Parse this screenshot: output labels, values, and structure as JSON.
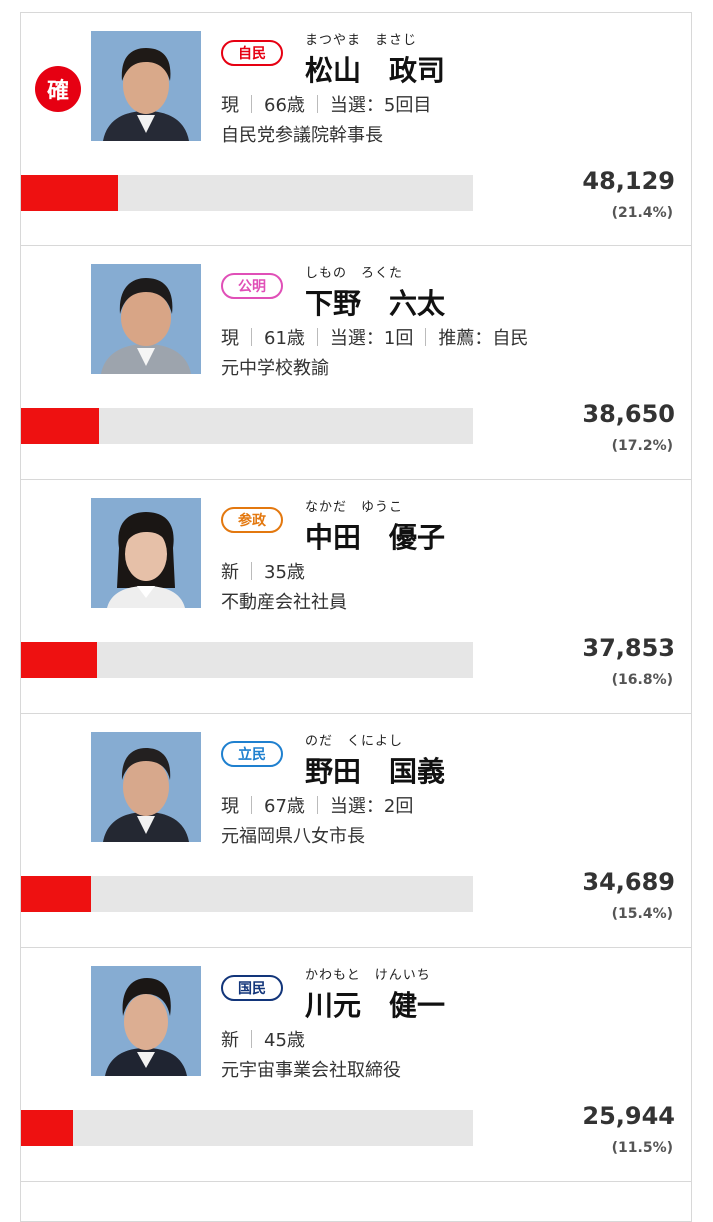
{
  "candidates": [
    {
      "elected_label": "確",
      "party": "自民",
      "party_color": "#e60012",
      "furigana": "まつやま　まさじ",
      "name": "松山　政司",
      "meta": [
        "現",
        "66歳",
        "当選：5回目"
      ],
      "title": "自民党参議院幹事長",
      "votes": "48,129",
      "percent": "(21.4%)",
      "bar_fraction": 0.214,
      "photo": {
        "bg": "#86acd2",
        "hair": "#1f1a17",
        "skin": "#d9a98a",
        "suit": "#262a36",
        "shirt": "#f2f2f2"
      }
    },
    {
      "party": "公明",
      "party_color": "#e04fb7",
      "furigana": "しもの　ろくた",
      "name": "下野　六太",
      "meta": [
        "現",
        "61歳",
        "当選：1回",
        "推薦：自民"
      ],
      "title": "元中学校教諭",
      "votes": "38,650",
      "percent": "(17.2%)",
      "bar_fraction": 0.172,
      "photo": {
        "bg": "#86acd2",
        "hair": "#1d1b1b",
        "skin": "#d8a586",
        "suit": "#9da4ad",
        "shirt": "#f5f5f5"
      }
    },
    {
      "party": "参政",
      "party_color": "#e3780f",
      "furigana": "なかだ　ゆうこ",
      "name": "中田　優子",
      "meta": [
        "新",
        "35歳"
      ],
      "title": "不動産会社社員",
      "votes": "37,853",
      "percent": "(16.8%)",
      "bar_fraction": 0.168,
      "photo": {
        "bg": "#86acd2",
        "hair": "#1a1614",
        "skin": "#e6c0a8",
        "suit": "#eeeeee",
        "shirt": "#ffffff"
      }
    },
    {
      "party": "立民",
      "party_color": "#1f80cf",
      "furigana": "のだ　くによし",
      "name": "野田　国義",
      "meta": [
        "現",
        "67歳",
        "当選：2回"
      ],
      "title": "元福岡県八女市長",
      "votes": "34,689",
      "percent": "(15.4%)",
      "bar_fraction": 0.154,
      "photo": {
        "bg": "#86acd2",
        "hair": "#232020",
        "skin": "#d7a88c",
        "suit": "#242832",
        "shirt": "#f2f2f2"
      }
    },
    {
      "party": "国民",
      "party_color": "#12357a",
      "furigana": "かわもと　けんいち",
      "name": "川元　健一",
      "meta": [
        "新",
        "45歳"
      ],
      "title": "元宇宙事業会社取締役",
      "votes": "25,944",
      "percent": "(11.5%)",
      "bar_fraction": 0.115,
      "photo": {
        "bg": "#86acd2",
        "hair": "#1b1715",
        "skin": "#dcae92",
        "suit": "#1f2431",
        "shirt": "#f2f2f2"
      }
    }
  ]
}
